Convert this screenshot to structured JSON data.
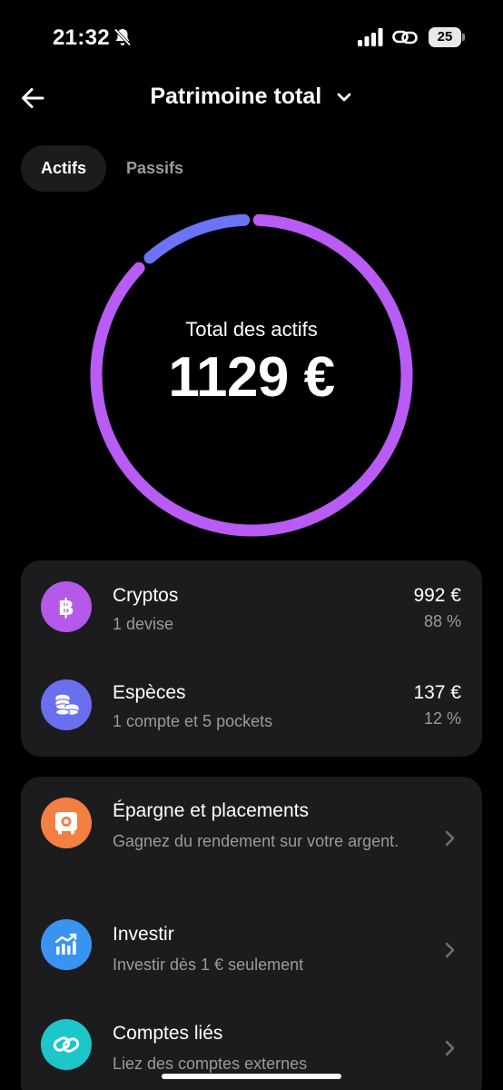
{
  "status_bar": {
    "time": "21:32",
    "battery": "25"
  },
  "header": {
    "title": "Patrimoine total"
  },
  "tabs": [
    {
      "label": "Actifs",
      "active": true
    },
    {
      "label": "Passifs",
      "active": false
    }
  ],
  "summary": {
    "label": "Total des actifs",
    "value": "1129 €"
  },
  "chart_data": {
    "type": "pie",
    "categories": [
      "Cryptos",
      "Espèces"
    ],
    "values": [
      992,
      137
    ],
    "percent": [
      88,
      12
    ],
    "colors": [
      "#b85cf5",
      "#6b73f7"
    ]
  },
  "assets": [
    {
      "name": "Cryptos",
      "subtitle": "1 devise",
      "amount": "992 €",
      "percent": "88 %",
      "icon": "bitcoin-icon",
      "color": "#b459ea"
    },
    {
      "name": "Espèces",
      "subtitle": "1 compte et 5 pockets",
      "amount": "137 €",
      "percent": "12 %",
      "icon": "coins-icon",
      "color": "#6a6ff0"
    }
  ],
  "links": [
    {
      "title": "Épargne et placements",
      "subtitle": "Gagnez du rendement sur votre argent.",
      "icon": "safe-icon",
      "color": "#f37f43"
    },
    {
      "title": "Investir",
      "subtitle": "Investir dès 1 € seulement",
      "icon": "chart-up-icon",
      "color": "#3b93f1"
    },
    {
      "title": "Comptes liés",
      "subtitle": "Liez des comptes externes",
      "icon": "link-icon",
      "color": "#1dc6c9"
    }
  ]
}
